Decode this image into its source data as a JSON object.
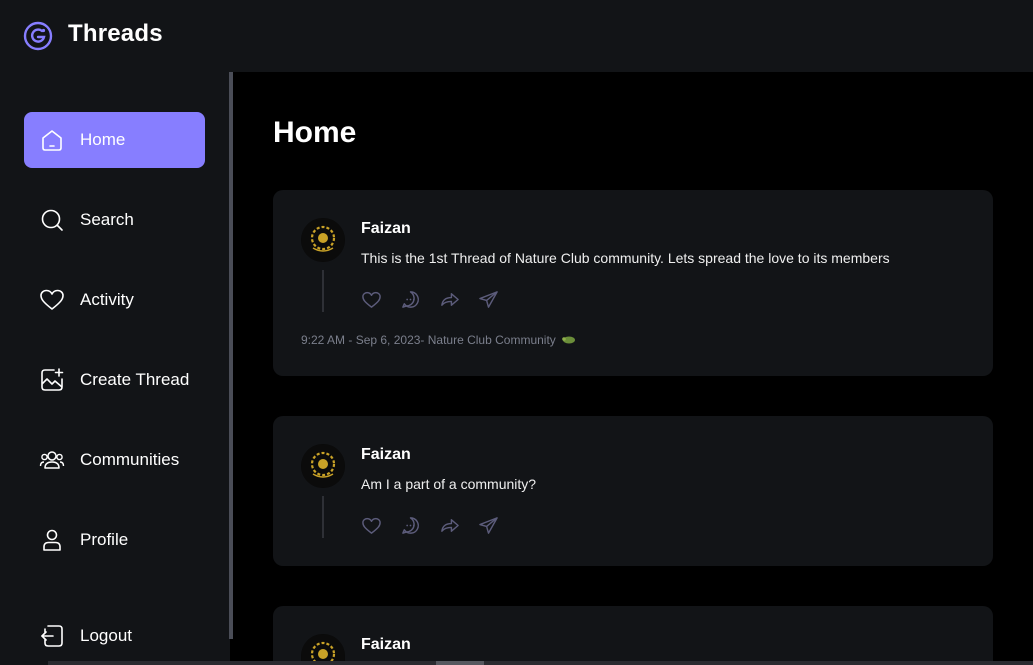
{
  "app": {
    "name": "Threads"
  },
  "sidebar": {
    "items": [
      {
        "label": "Home",
        "icon": "home-icon",
        "active": true
      },
      {
        "label": "Search",
        "icon": "search-icon",
        "active": false
      },
      {
        "label": "Activity",
        "icon": "heart-icon",
        "active": false
      },
      {
        "label": "Create Thread",
        "icon": "image-plus-icon",
        "active": false
      },
      {
        "label": "Communities",
        "icon": "users-icon",
        "active": false
      },
      {
        "label": "Profile",
        "icon": "user-icon",
        "active": false
      }
    ],
    "logout": {
      "label": "Logout",
      "icon": "logout-icon"
    }
  },
  "main": {
    "title": "Home",
    "threads": [
      {
        "author": "Faizan",
        "text": "This is the 1st Thread of Nature Club community. Lets spread the love to its members",
        "meta": "9:22 AM - Sep 6, 2023- Nature Club Community"
      },
      {
        "author": "Faizan",
        "text": "Am I a part of a community?",
        "meta": ""
      },
      {
        "author": "Faizan",
        "text": "",
        "meta": ""
      }
    ]
  },
  "colors": {
    "accent": "#877eff",
    "background": "#000000",
    "panel": "#121417",
    "muted_text": "#7b7f8c"
  }
}
